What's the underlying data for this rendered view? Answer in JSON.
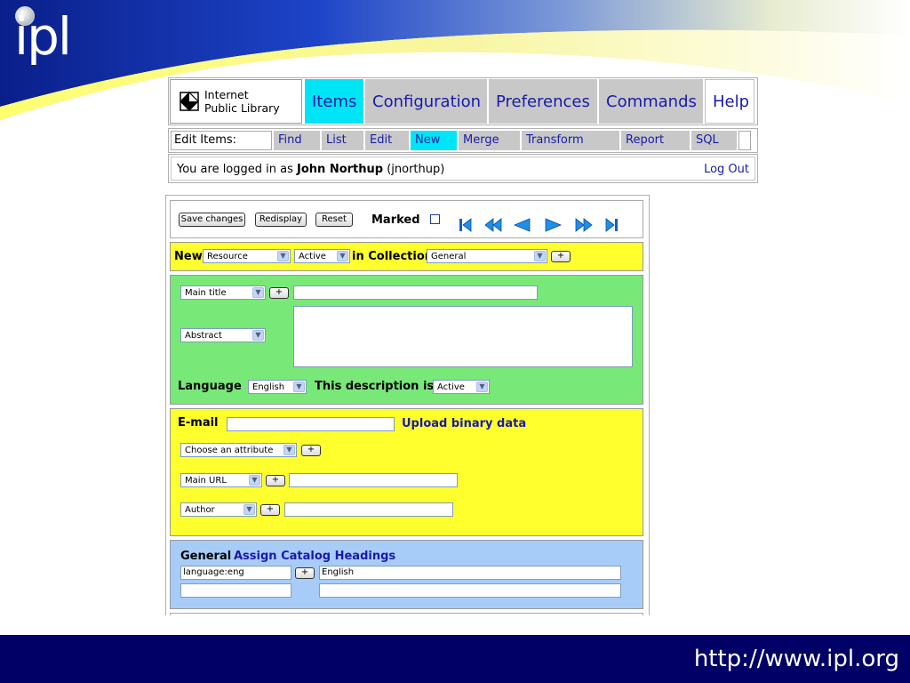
{
  "slide": {
    "logo_text": "ipl",
    "footer_url": "http://www.ipl.org",
    "colors": {
      "banner_blue": "#0a2a9a",
      "banner_yellow": "#f4f3a0",
      "footer_navy": "#000066"
    }
  },
  "navbar": {
    "brand_line1": "Internet",
    "brand_line2": "Public Library",
    "tabs": [
      {
        "label": "Items",
        "active": true
      },
      {
        "label": "Configuration",
        "active": false
      },
      {
        "label": "Preferences",
        "active": false
      },
      {
        "label": "Commands",
        "active": false
      },
      {
        "label": "Help",
        "active": false
      }
    ]
  },
  "subbar": {
    "label": "Edit Items:",
    "tabs": [
      {
        "label": "Find",
        "active": false
      },
      {
        "label": "List",
        "active": false
      },
      {
        "label": "Edit",
        "active": false
      },
      {
        "label": "New",
        "active": true
      },
      {
        "label": "Merge",
        "active": false
      },
      {
        "label": "Transform",
        "active": false
      },
      {
        "label": "Report",
        "active": false
      },
      {
        "label": "SQL",
        "active": false
      }
    ]
  },
  "login": {
    "prefix": "You are logged in as ",
    "user_name": "John Northup",
    "user_id": " (jnorthup)",
    "logout": "Log Out"
  },
  "toolbar": {
    "save_label": "Save changes",
    "redisplay_label": "Redisplay",
    "reset_label": "Reset",
    "marked_label": "Marked"
  },
  "new_row": {
    "new_label": "New",
    "type_value": "Resource",
    "status_value": "Active",
    "collection_label": "in Collection",
    "collection_value": "General",
    "plus": "+"
  },
  "description": {
    "title_select": "Main title",
    "title_value": "",
    "abstract_select": "Abstract",
    "abstract_value": "",
    "language_label": "Language",
    "language_value": "English",
    "status_label": "This description is",
    "status_value": "Active"
  },
  "attributes": {
    "email_label": "E-mail",
    "email_value": "",
    "upload_link": "Upload binary data",
    "attr_select": "Choose an attribute",
    "url_select": "Main URL",
    "url_value": "",
    "author_select": "Author",
    "author_value": ""
  },
  "catalog": {
    "collection_label": "General",
    "assign_link": "Assign Catalog Headings",
    "heading_code": "language:eng",
    "heading_value": "English",
    "blank_code": "",
    "blank_value": ""
  }
}
